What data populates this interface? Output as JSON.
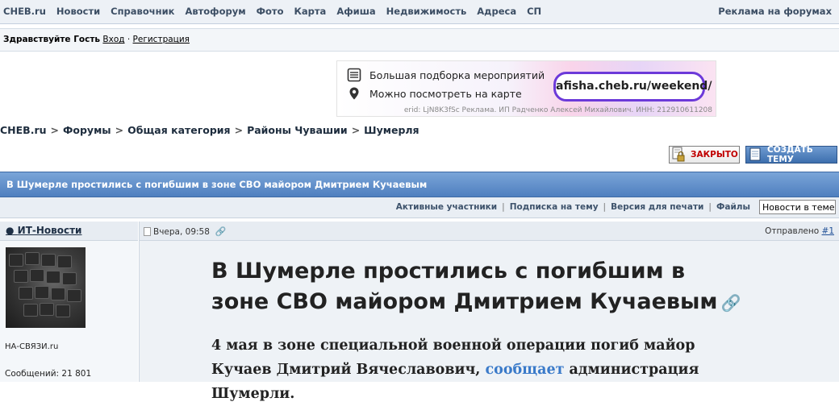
{
  "topnav": {
    "items": [
      "CHEB.ru",
      "Новости",
      "Справочник",
      "Автофорум",
      "Фото",
      "Карта",
      "Афиша",
      "Недвижимость",
      "Адреса",
      "СП"
    ],
    "right": "Реклама на форумах"
  },
  "userbar": {
    "greeting": "Здравствуйте Гость",
    "login": "Вход",
    "sep": "·",
    "register": "Регистрация"
  },
  "ad": {
    "line1": "Большая подборка мероприятий",
    "line2": "Можно посмотреть на карте",
    "url": "afisha.cheb.ru/weekend/",
    "erid": "erid: LjN8K3fSc Реклама. ИП Радченко Алексей Михайлович. ИНН: 212910611208",
    "accent": "#6c39d9"
  },
  "breadcrumb": [
    "CHEB.ru",
    "Форумы",
    "Общая категория",
    "Районы Чувашии",
    "Шумерля"
  ],
  "buttons": {
    "closed": "ЗАКРЫТО",
    "new_topic": "СОЗДАТЬ ТЕМУ"
  },
  "topic": {
    "title": "В Шумерле простились с погибшим в зоне СВО майором Дмитрием Кучаевым"
  },
  "options": {
    "items": [
      "Активные участники",
      "Подписка на тему",
      "Версия для печати",
      "Файлы"
    ],
    "select_value": "Новости в теме"
  },
  "post": {
    "author": "ИТ-Новости",
    "date": "Вчера, 09:58",
    "sent_label": "Отправлено",
    "post_number": "#1",
    "group": "НА-СВЯЗИ.ru",
    "messages": "Сообщений: 21 801",
    "title": "В Шумерле простились с погибшим в зоне СВО майором Дмитрием Кучаевым",
    "body_before": "4 мая в зоне специальной военной операции погиб майор Кучаев Дмитрий Вячеславович, ",
    "body_link": "сообщает",
    "body_after": " администрация Шумерли."
  }
}
